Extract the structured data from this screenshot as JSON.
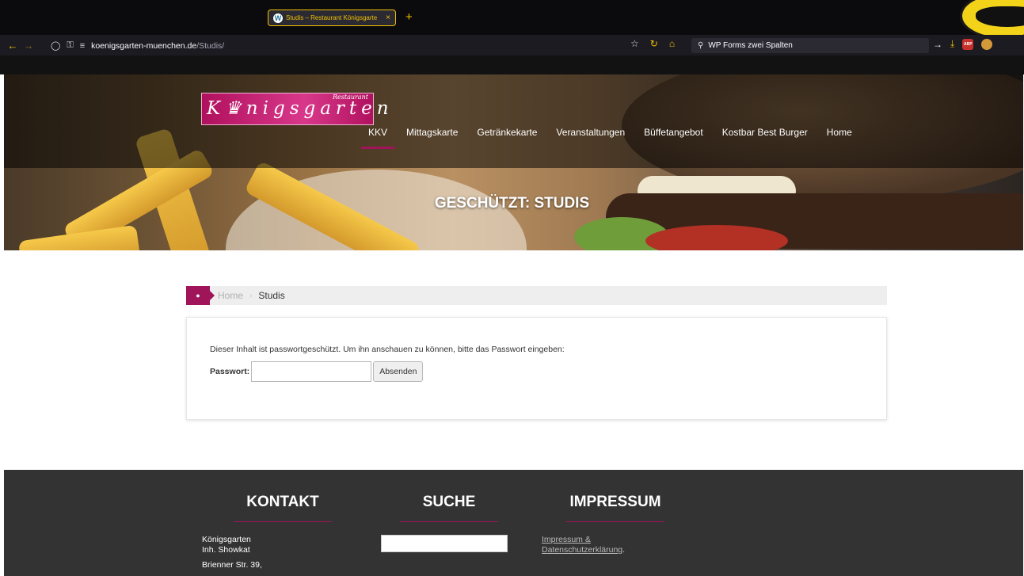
{
  "browser": {
    "tab_title": "Studis – Restaurant Königsgarten ×",
    "tab_title_short": "Studis – Restaurant Königsgarte",
    "new_tab": "+",
    "url_host": "koenigsgarten-muenchen.de",
    "url_path": "/Studis/",
    "search_text": "WP Forms zwei Spalten",
    "abp_label": "ABP"
  },
  "site": {
    "logo_small": "Restaurant",
    "logo_main": "K♛nigsgarten",
    "nav": [
      "KKV",
      "Mittagskarte",
      "Getränkekarte",
      "Veranstaltungen",
      "Büffetangebot",
      "Kostbar Best Burger",
      "Home"
    ],
    "hero_title": "GESCHÜTZT: STUDIS"
  },
  "breadcrumb": {
    "home": "Home",
    "current": "Studis"
  },
  "content": {
    "notice": "Dieser Inhalt ist passwortgeschützt. Um ihn anschauen zu können, bitte das Passwort eingeben:",
    "password_label": "Passwort:",
    "password_value": "",
    "submit_label": "Absenden"
  },
  "footer": {
    "kontakt_heading": "KONTAKT",
    "suche_heading": "SUCHE",
    "impressum_heading": "IMPRESSUM",
    "kontakt_lines": [
      "Königsgarten",
      "Inh. Showkat",
      "Brienner Str. 39,"
    ],
    "impressum_link_1": "Impressum &",
    "impressum_link_2": "Datenschutzerklärung",
    "impressum_suffix": "."
  },
  "colors": {
    "accent": "#a0155a",
    "browser_accent": "#f0c000",
    "footer_bg": "#333333"
  }
}
